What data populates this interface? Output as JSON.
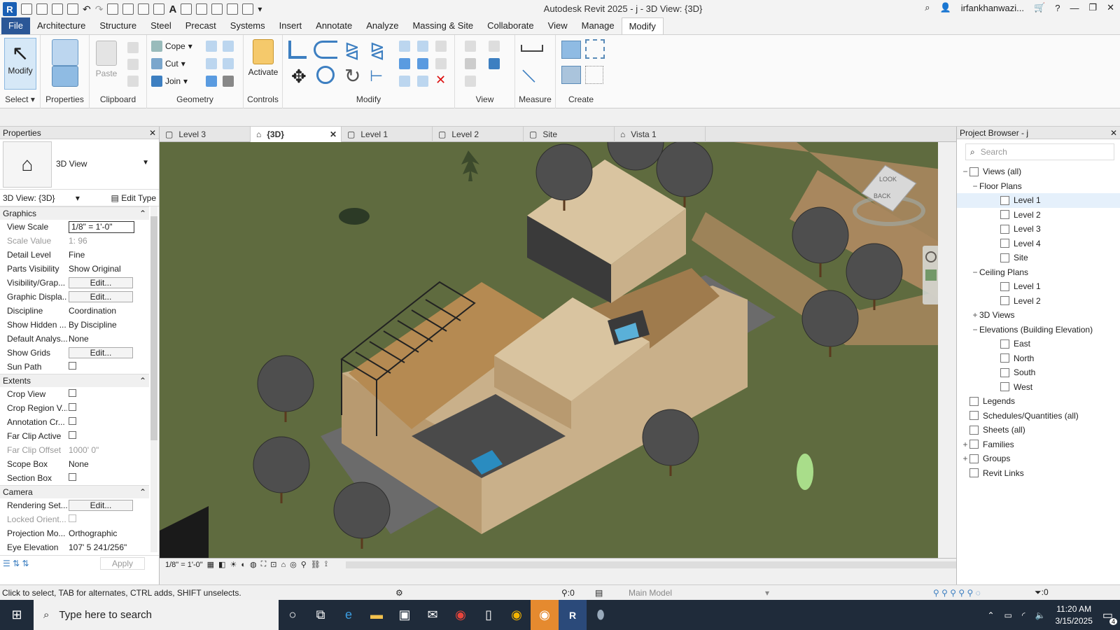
{
  "titlebar": {
    "title": "Autodesk Revit 2025 - j - 3D View: {3D}",
    "user": "irfankhanwazi...",
    "logo": "R"
  },
  "menu": {
    "tabs": [
      "File",
      "Architecture",
      "Structure",
      "Steel",
      "Precast",
      "Systems",
      "Insert",
      "Annotate",
      "Analyze",
      "Massing & Site",
      "Collaborate",
      "View",
      "Manage",
      "Modify"
    ],
    "active": "Modify"
  },
  "ribbon": {
    "modify_label": "Modify",
    "select_label": "Select",
    "properties_label": "Properties",
    "paste_label": "Paste",
    "clipboard_label": "Clipboard",
    "cope_label": "Cope",
    "cut_label": "Cut",
    "join_label": "Join",
    "geometry_label": "Geometry",
    "activate_label": "Activate",
    "controls_label": "Controls",
    "modify_panel_label": "Modify",
    "view_label": "View",
    "measure_label": "Measure",
    "create_label": "Create"
  },
  "properties": {
    "header": "Properties",
    "type_name": "3D View",
    "instance_selector": "3D View: {3D}",
    "edit_type": "Edit Type",
    "groups": {
      "graphics": "Graphics",
      "extents": "Extents",
      "camera": "Camera"
    },
    "rows": {
      "view_scale": {
        "name": "View Scale",
        "value": "1/8\" = 1'-0\""
      },
      "scale_value": {
        "name": "Scale Value",
        "value": "1:  96"
      },
      "detail_level": {
        "name": "Detail Level",
        "value": "Fine"
      },
      "parts_visibility": {
        "name": "Parts Visibility",
        "value": "Show Original"
      },
      "visibility_graphics": {
        "name": "Visibility/Grap...",
        "value": "Edit..."
      },
      "graphic_display": {
        "name": "Graphic Displa...",
        "value": "Edit..."
      },
      "discipline": {
        "name": "Discipline",
        "value": "Coordination"
      },
      "show_hidden": {
        "name": "Show Hidden ...",
        "value": "By Discipline"
      },
      "default_analysis": {
        "name": "Default Analys...",
        "value": "None"
      },
      "show_grids": {
        "name": "Show Grids",
        "value": "Edit..."
      },
      "sun_path": {
        "name": "Sun Path",
        "value": ""
      },
      "crop_view": {
        "name": "Crop View",
        "value": ""
      },
      "crop_region": {
        "name": "Crop Region V...",
        "value": ""
      },
      "annotation_crop": {
        "name": "Annotation Cr...",
        "value": ""
      },
      "far_clip_active": {
        "name": "Far Clip Active",
        "value": ""
      },
      "far_clip_offset": {
        "name": "Far Clip Offset",
        "value": "1000'  0\""
      },
      "scope_box": {
        "name": "Scope Box",
        "value": "None"
      },
      "section_box": {
        "name": "Section Box",
        "value": ""
      },
      "rendering_settings": {
        "name": "Rendering Set...",
        "value": "Edit..."
      },
      "locked_orientation": {
        "name": "Locked Orient...",
        "value": ""
      },
      "projection_mode": {
        "name": "Projection Mo...",
        "value": "Orthographic"
      },
      "eye_elevation": {
        "name": "Eye Elevation",
        "value": "107'  5 241/256\""
      }
    },
    "apply": "Apply"
  },
  "view_tabs": [
    {
      "label": "Level 3"
    },
    {
      "label": "{3D}"
    },
    {
      "label": "Level 1"
    },
    {
      "label": "Level 2"
    },
    {
      "label": "Site"
    },
    {
      "label": "Vista 1"
    }
  ],
  "view_status": {
    "scale": "1/8\" = 1'-0\""
  },
  "viewcube": {
    "face1": "LOOK",
    "face2": "BACK"
  },
  "browser": {
    "header": "Project Browser - j",
    "search_placeholder": "Search",
    "views_all": "Views (all)",
    "floor_plans": "Floor Plans",
    "floor_items": [
      "Level 1",
      "Level 2",
      "Level 3",
      "Level 4",
      "Site"
    ],
    "ceiling_plans": "Ceiling Plans",
    "ceiling_items": [
      "Level 1",
      "Level 2"
    ],
    "views_3d": "3D Views",
    "elevations": "Elevations (Building Elevation)",
    "elevation_items": [
      "East",
      "North",
      "South",
      "West"
    ],
    "legends": "Legends",
    "schedules": "Schedules/Quantities (all)",
    "sheets": "Sheets (all)",
    "families": "Families",
    "groups": "Groups",
    "revit_links": "Revit Links"
  },
  "statusbar": {
    "hint": "Click to select, TAB for alternates, CTRL adds, SHIFT unselects.",
    "workset_count": ":0",
    "model": "Main Model",
    "filter_count": ":0"
  },
  "taskbar": {
    "search_placeholder": "Type here to search",
    "time": "11:20 AM",
    "date": "3/15/2025",
    "notif": "4"
  },
  "colors": {
    "ground": "#5f6b3f",
    "wall": "#c9b08a",
    "roof": "#d9c4a0",
    "tree": "#4e4e4e",
    "path": "#a8875e"
  }
}
